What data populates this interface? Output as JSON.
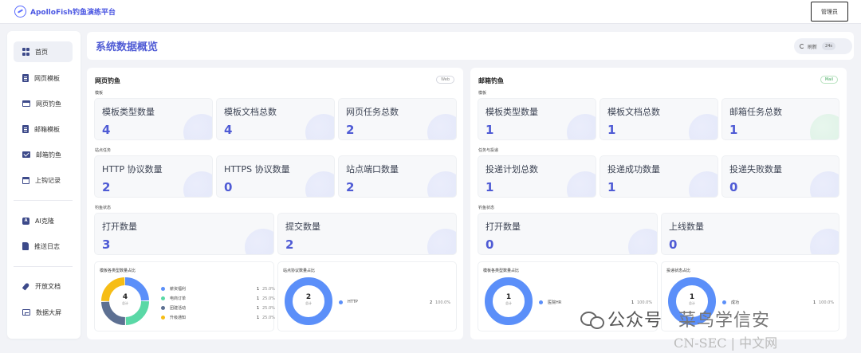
{
  "app": {
    "title": "ApolloFish钓鱼演练平台",
    "user_button": "管理员"
  },
  "sidebar": {
    "items": [
      {
        "label": "首页",
        "icon": "dashboard-grid-icon"
      },
      {
        "label": "网页模板",
        "icon": "document-icon"
      },
      {
        "label": "网页钓鱼",
        "icon": "browser-window-icon"
      },
      {
        "label": "邮箱模板",
        "icon": "document-icon"
      },
      {
        "label": "邮箱钓鱼",
        "icon": "mail-icon"
      },
      {
        "label": "上钩记录",
        "icon": "calendar-icon"
      },
      {
        "label": "AI克隆",
        "icon": "ai-icon"
      },
      {
        "label": "推送日志",
        "icon": "log-icon"
      },
      {
        "label": "开放文档",
        "icon": "rocket-icon"
      },
      {
        "label": "数据大屏",
        "icon": "screen-icon"
      }
    ],
    "active_index": 0
  },
  "header": {
    "title": "系统数据概览",
    "refresh_label": "刷新",
    "refresh_countdown": "24s"
  },
  "web_panel": {
    "title": "网页钓鱼",
    "tag": "Web",
    "sections": [
      {
        "label": "模板",
        "stats": [
          {
            "label": "模板类型数量",
            "value": "4"
          },
          {
            "label": "模板文档总数",
            "value": "4"
          },
          {
            "label": "网页任务总数",
            "value": "2"
          }
        ]
      },
      {
        "label": "站点任务",
        "stats": [
          {
            "label": "HTTP 协议数量",
            "value": "2"
          },
          {
            "label": "HTTPS 协议数量",
            "value": "0"
          },
          {
            "label": "站点端口数量",
            "value": "2"
          }
        ]
      },
      {
        "label": "钓鱼状态",
        "stats": [
          {
            "label": "打开数量",
            "value": "3"
          },
          {
            "label": "提交数量",
            "value": "2"
          }
        ]
      }
    ],
    "charts": [
      {
        "title": "模板各类型数量占比",
        "total": "4",
        "total_label": "总计",
        "legend": [
          {
            "label": "薪资福利",
            "count": "1",
            "pct": "25.0%",
            "color": "#5b8ff9"
          },
          {
            "label": "电商订单",
            "count": "1",
            "pct": "25.0%",
            "color": "#5ad8a6"
          },
          {
            "label": "团建活动",
            "count": "1",
            "pct": "25.0%",
            "color": "#5d7092"
          },
          {
            "label": "升级通知",
            "count": "1",
            "pct": "25.0%",
            "color": "#f6bd16"
          }
        ]
      },
      {
        "title": "站点协议数量占比",
        "total": "2",
        "total_label": "总计",
        "legend": [
          {
            "label": "HTTP",
            "count": "2",
            "pct": "100.0%",
            "color": "#5b8ff9"
          }
        ]
      }
    ]
  },
  "mail_panel": {
    "title": "邮箱钓鱼",
    "tag": "Mail",
    "sections": [
      {
        "label": "模板",
        "stats": [
          {
            "label": "模板类型数量",
            "value": "1"
          },
          {
            "label": "模板文档总数",
            "value": "1"
          },
          {
            "label": "邮箱任务总数",
            "value": "1"
          }
        ]
      },
      {
        "label": "任务与投递",
        "stats": [
          {
            "label": "投递计划总数",
            "value": "1"
          },
          {
            "label": "投递成功数量",
            "value": "1"
          },
          {
            "label": "投递失败数量",
            "value": "0"
          }
        ]
      },
      {
        "label": "钓鱼状态",
        "stats": [
          {
            "label": "打开数量",
            "value": "0"
          },
          {
            "label": "上线数量",
            "value": "0"
          }
        ]
      }
    ],
    "charts": [
      {
        "title": "模板各类型数量占比",
        "total": "1",
        "total_label": "总计",
        "legend": [
          {
            "label": "医院HR",
            "count": "1",
            "pct": "100.0%",
            "color": "#5b8ff9"
          }
        ]
      },
      {
        "title": "投递状态占比",
        "total": "1",
        "total_label": "总计",
        "legend": [
          {
            "label": "成功",
            "count": "1",
            "pct": "100.0%",
            "color": "#5b8ff9"
          }
        ]
      }
    ]
  },
  "watermark": {
    "text1": "公众号",
    "text2": "菜鸟学信安",
    "text3": "CN-SEC | 中文网"
  }
}
